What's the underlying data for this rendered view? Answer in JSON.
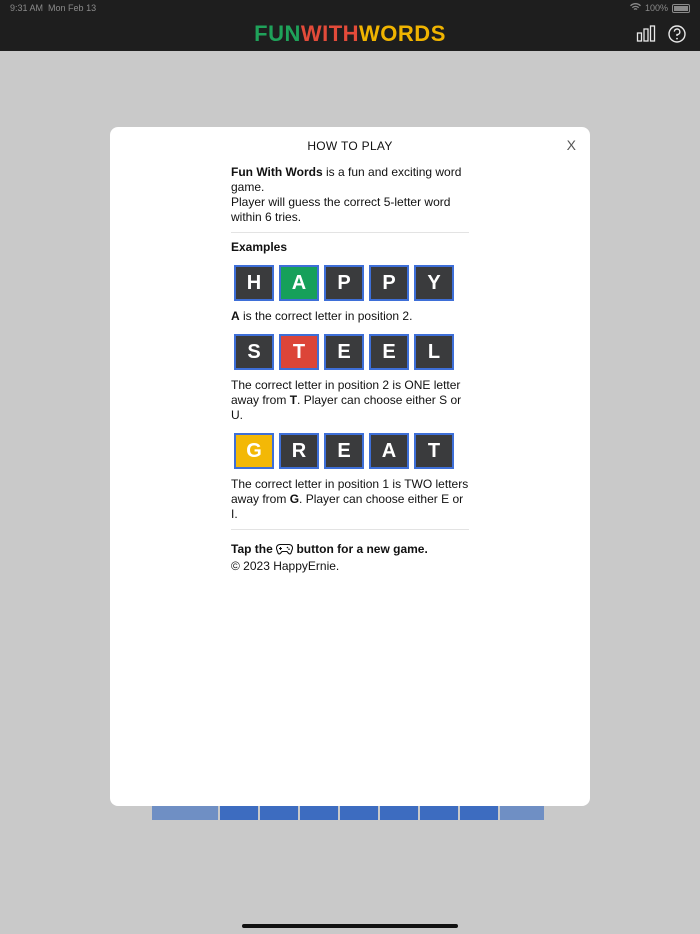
{
  "status": {
    "time": "9:31 AM",
    "date": "Mon Feb 13",
    "battery": "100%"
  },
  "app": {
    "title_parts": [
      {
        "text": "FUN",
        "color": "#1fa25a"
      },
      {
        "text": "WITH",
        "color": "#e34b3a"
      },
      {
        "text": "WORDS",
        "color": "#f0b400"
      }
    ],
    "icons": [
      "bar-chart-icon",
      "help-icon"
    ]
  },
  "modal": {
    "title": "HOW TO PLAY",
    "close": "X",
    "intro_bold": "Fun With Words",
    "intro_rest": " is a fun and exciting word game.",
    "intro_line2": "Player will guess the correct 5-letter word within 6 tries.",
    "examples_heading": "Examples",
    "examples": [
      {
        "tiles": [
          "H",
          "A",
          "P",
          "P",
          "Y"
        ],
        "colors": [
          "#3a3b3d",
          "#16a05a",
          "#3a3b3d",
          "#3a3b3d",
          "#3a3b3d"
        ],
        "desc_parts": [
          {
            "text": "A",
            "bold": true
          },
          {
            "text": " is the correct letter in position 2.",
            "bold": false
          }
        ]
      },
      {
        "tiles": [
          "S",
          "T",
          "E",
          "E",
          "L"
        ],
        "colors": [
          "#3a3b3d",
          "#dc4538",
          "#3a3b3d",
          "#3a3b3d",
          "#3a3b3d"
        ],
        "desc_parts": [
          {
            "text": "The correct letter in position 2 is ONE letter away from ",
            "bold": false
          },
          {
            "text": "T",
            "bold": true
          },
          {
            "text": ". Player can choose either S or U.",
            "bold": false
          }
        ]
      },
      {
        "tiles": [
          "G",
          "R",
          "E",
          "A",
          "T"
        ],
        "colors": [
          "#f3b806",
          "#3a3b3d",
          "#3a3b3d",
          "#3a3b3d",
          "#3a3b3d"
        ],
        "desc_parts": [
          {
            "text": "The correct letter in position 1 is TWO letters away from ",
            "bold": false
          },
          {
            "text": "G",
            "bold": true
          },
          {
            "text": ". Player can choose either E or I.",
            "bold": false
          }
        ]
      }
    ],
    "footer_tap": "Tap the",
    "footer_rest": "button for a new game.",
    "copyright": "© 2023 HappyErnie."
  }
}
